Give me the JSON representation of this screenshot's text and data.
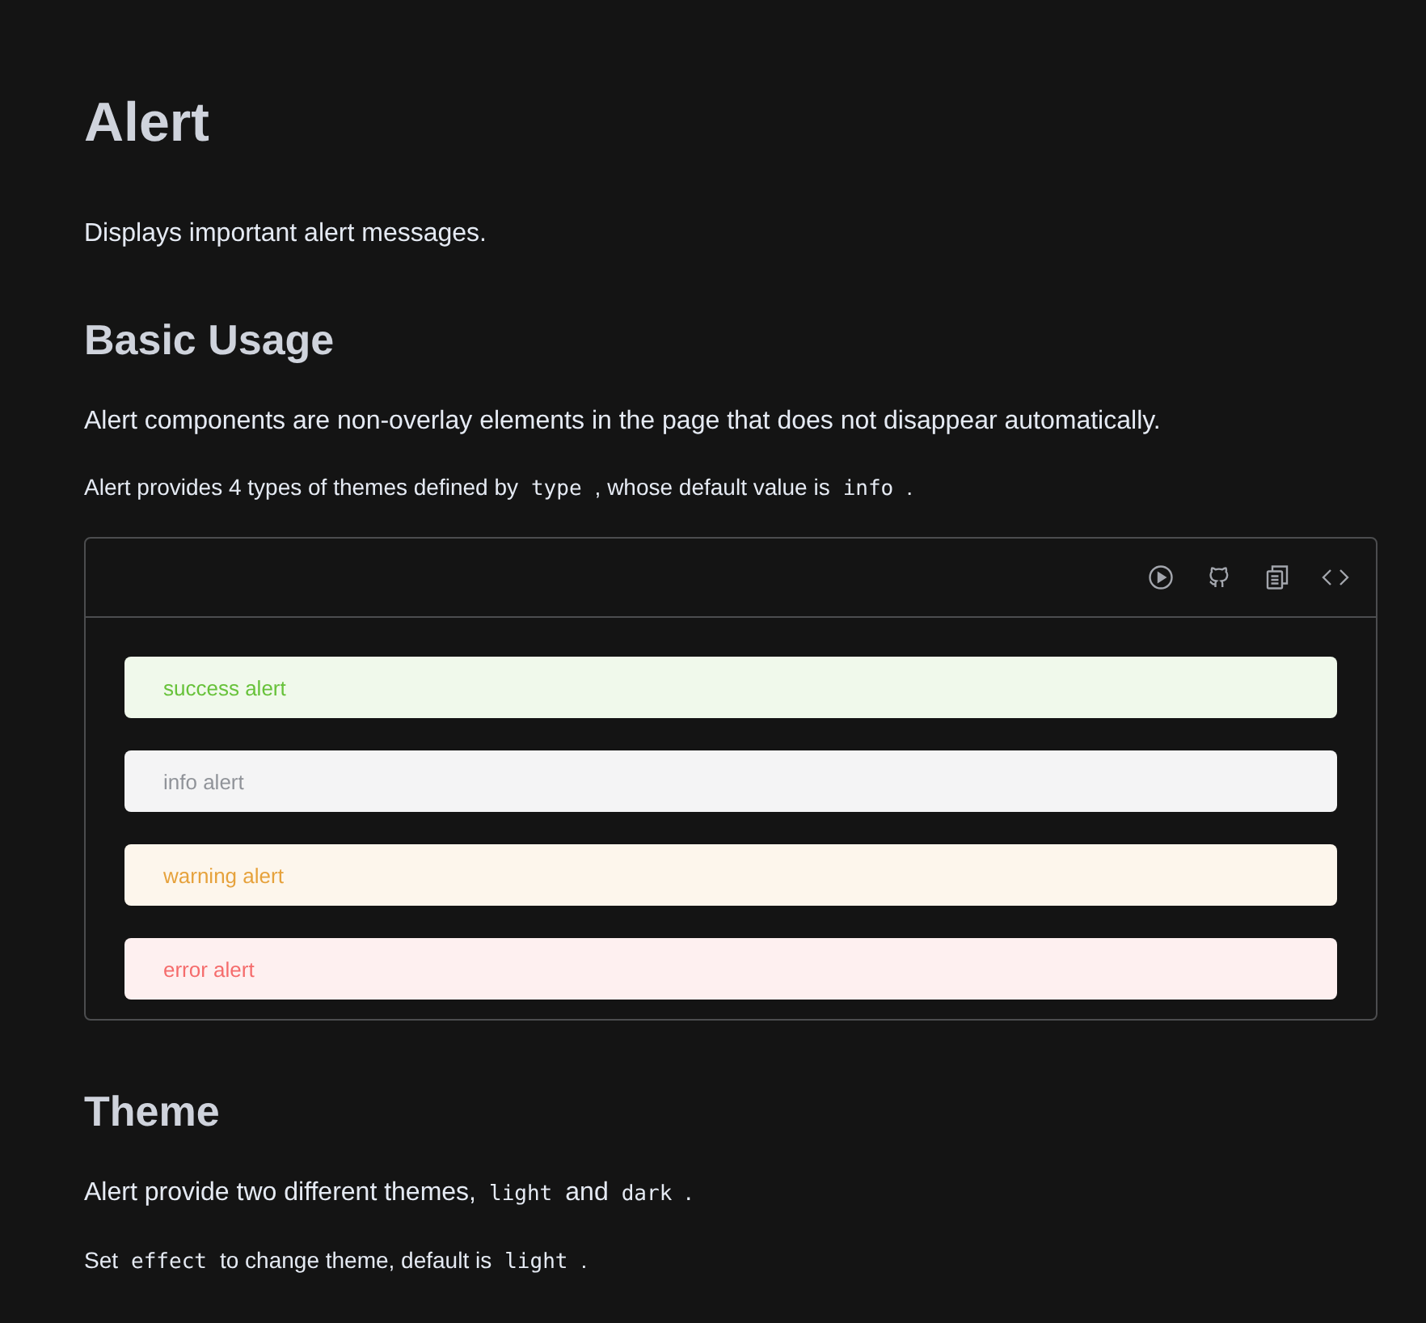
{
  "title": "Alert",
  "description": "Displays important alert messages.",
  "sections": [
    {
      "heading": "Basic Usage",
      "paragraphs": [
        {
          "kind": "lead",
          "parts": [
            {
              "kind": "text",
              "text": "Alert components are non-overlay elements in the page that does not disappear automatically."
            }
          ]
        },
        {
          "kind": "note",
          "parts": [
            {
              "kind": "text",
              "text": "Alert provides 4 types of themes defined by"
            },
            {
              "kind": "code",
              "text": "type"
            },
            {
              "kind": "text",
              "text": ", whose default value is"
            },
            {
              "kind": "code",
              "text": "info"
            },
            {
              "kind": "text",
              "text": "."
            }
          ]
        }
      ],
      "demo": {
        "alerts": [
          {
            "kind": "success",
            "text": "success alert"
          },
          {
            "kind": "info",
            "text": "info alert"
          },
          {
            "kind": "warning",
            "text": "warning alert"
          },
          {
            "kind": "error",
            "text": "error alert"
          }
        ]
      }
    },
    {
      "heading": "Theme",
      "paragraphs": [
        {
          "kind": "lead",
          "parts": [
            {
              "kind": "text",
              "text": "Alert provide two different themes,"
            },
            {
              "kind": "code",
              "text": "light"
            },
            {
              "kind": "text",
              "text": "and"
            },
            {
              "kind": "code",
              "text": "dark"
            },
            {
              "kind": "text",
              "text": "."
            }
          ]
        },
        {
          "kind": "note",
          "parts": [
            {
              "kind": "text",
              "text": "Set"
            },
            {
              "kind": "code",
              "text": "effect"
            },
            {
              "kind": "text",
              "text": "to change theme, default is"
            },
            {
              "kind": "code",
              "text": "light"
            },
            {
              "kind": "text",
              "text": "."
            }
          ]
        }
      ]
    }
  ]
}
